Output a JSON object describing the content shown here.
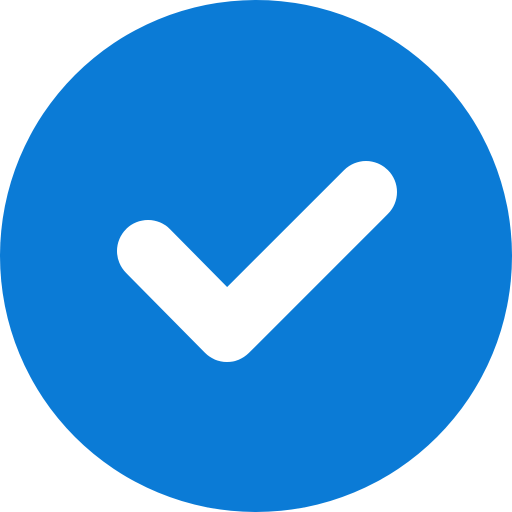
{
  "icon": {
    "name": "check-circle-icon",
    "circle_color": "#0B7BD6",
    "check_color": "#FFFFFF",
    "background_color": "#FFFFFF"
  }
}
